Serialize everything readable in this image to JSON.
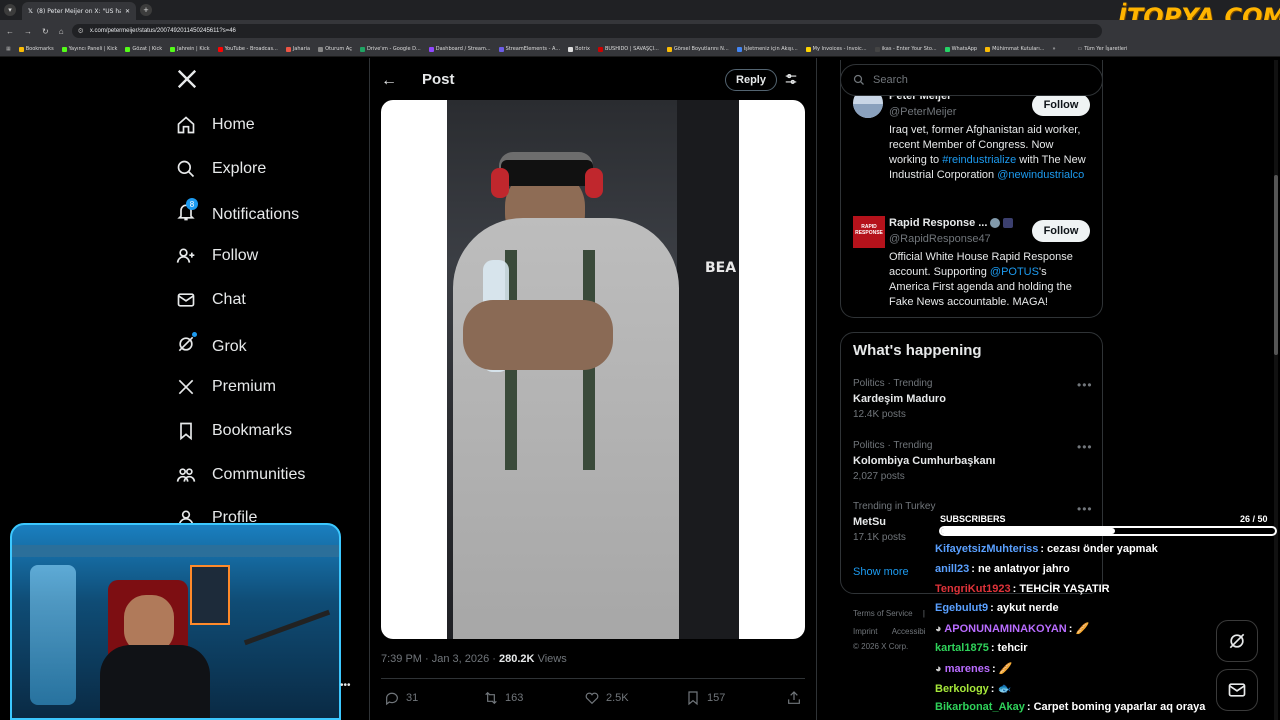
{
  "browser": {
    "tab_title": "(8) Peter Meijer on X: \"US hard",
    "url": "x.com/petermeijer/status/2007492011450245611?s=46",
    "bookmarks": [
      "Bookmarks",
      "Yayıncı Paneli | Kick",
      "Gözat | Kick",
      "Jahrein | Kick",
      "YouTube - Broadcas...",
      "Jaharia",
      "Oturum Aç",
      "Drive'ım - Google D...",
      "Dashboard / Stream...",
      "StreamElements - A...",
      "Botrix",
      "BUSHIDO | SAVAŞÇI...",
      "Görsel Boyutlarını N...",
      "İşletmeniz için Akışı...",
      "My Invoices - Invoic...",
      "ikas - Enter Your Sto...",
      "WhatsApp",
      "Mühimmat Kutuları...",
      "»",
      "Tüm Yer İşaretleri"
    ],
    "watermark": "İTOPYA.COM"
  },
  "nav": {
    "items": [
      {
        "label": "Home",
        "icon": "home-icon"
      },
      {
        "label": "Explore",
        "icon": "search-icon"
      },
      {
        "label": "Notifications",
        "icon": "bell-icon",
        "badge": "8"
      },
      {
        "label": "Follow",
        "icon": "follow-icon"
      },
      {
        "label": "Chat",
        "icon": "mail-icon"
      },
      {
        "label": "Grok",
        "icon": "grok-icon"
      },
      {
        "label": "Premium",
        "icon": "x-logo-icon"
      },
      {
        "label": "Bookmarks",
        "icon": "bookmark-icon"
      },
      {
        "label": "Communities",
        "icon": "people-icon"
      },
      {
        "label": "Profile",
        "icon": "person-icon"
      }
    ]
  },
  "post": {
    "header_title": "Post",
    "reply_label": "Reply",
    "time": "7:39 PM · Jan 3, 2026 ·",
    "views": "280.2K",
    "views_label": "Views",
    "replies": "31",
    "reposts": "163",
    "likes": "2.5K",
    "bookmarks": "157",
    "image_text": "BEA"
  },
  "search": {
    "placeholder": "Search"
  },
  "who_to_follow": [
    {
      "name": "Peter Meijer",
      "handle": "@PeterMeijer",
      "bio_parts": [
        "Iraq vet, former Afghanistan aid worker, recent Member of Congress. Now working to ",
        "#reindustrialize",
        " with The New Industrial Corporation ",
        "@newindustrialco",
        ""
      ],
      "follow": "Follow"
    },
    {
      "name": "Rapid Response ...",
      "handle": "@RapidResponse47",
      "avatar_text": "RAPID RESPONSE",
      "bio_parts": [
        "Official White House Rapid Response account. Supporting ",
        "@POTUS",
        "'s America First agenda and holding the Fake News accountable. MAGA!",
        "",
        ""
      ],
      "follow": "Follow"
    }
  ],
  "happening": {
    "title": "What's happening",
    "trends": [
      {
        "context": "Politics · Trending",
        "name": "Kardeşim Maduro",
        "count": "12.4K posts"
      },
      {
        "context": "Politics · Trending",
        "name": "Kolombiya Cumhurbaşkanı",
        "count": "2,027 posts"
      },
      {
        "context": "Trending in Turkey",
        "name": "MetSu",
        "count": "17.1K posts"
      }
    ],
    "show_more": "Show more"
  },
  "footer": {
    "links": [
      "Terms of Service",
      "|",
      "Imprint",
      "Accessibi"
    ],
    "copyright": "© 2026 X Corp."
  },
  "stream": {
    "subscribers_label": "SUBSCRIBERS",
    "subscribers_count": "26 / 50",
    "subscribers_progress": 0.52,
    "chat": [
      {
        "user": "KifayetsizMuhteriss",
        "color": "#5aa0ff",
        "msg": ": cezası önder yapmak"
      },
      {
        "user": "anill23",
        "color": "#5aa0ff",
        "msg": ": ne anlatıyor jahro"
      },
      {
        "user": "TengriKut1923",
        "color": "#e0333a",
        "msg": ": TEHCİR YAŞATIR"
      },
      {
        "user": "Egebulut9",
        "color": "#5aa0ff",
        "msg": ": aykut nerde"
      },
      {
        "user": "APONUNAMINAKOYAN",
        "color": "#b96cff",
        "msg": ": 🥖",
        "badge": true
      },
      {
        "user": "kartal1875",
        "color": "#2fd25a",
        "msg": ": tehcir"
      },
      {
        "user": "marenes",
        "color": "#b96cff",
        "msg": ": 🥖",
        "badge": true
      },
      {
        "user": "Berkology",
        "color": "#a6e83a",
        "msg": ": 🐟"
      },
      {
        "user": "Bikarbonat_Akay",
        "color": "#2fd25a",
        "msg": ": Carpet boming yaparlar aq oraya"
      }
    ]
  },
  "colors": {
    "accent": "#1d9bf0",
    "bg": "#000000",
    "border": "#2f3336"
  }
}
